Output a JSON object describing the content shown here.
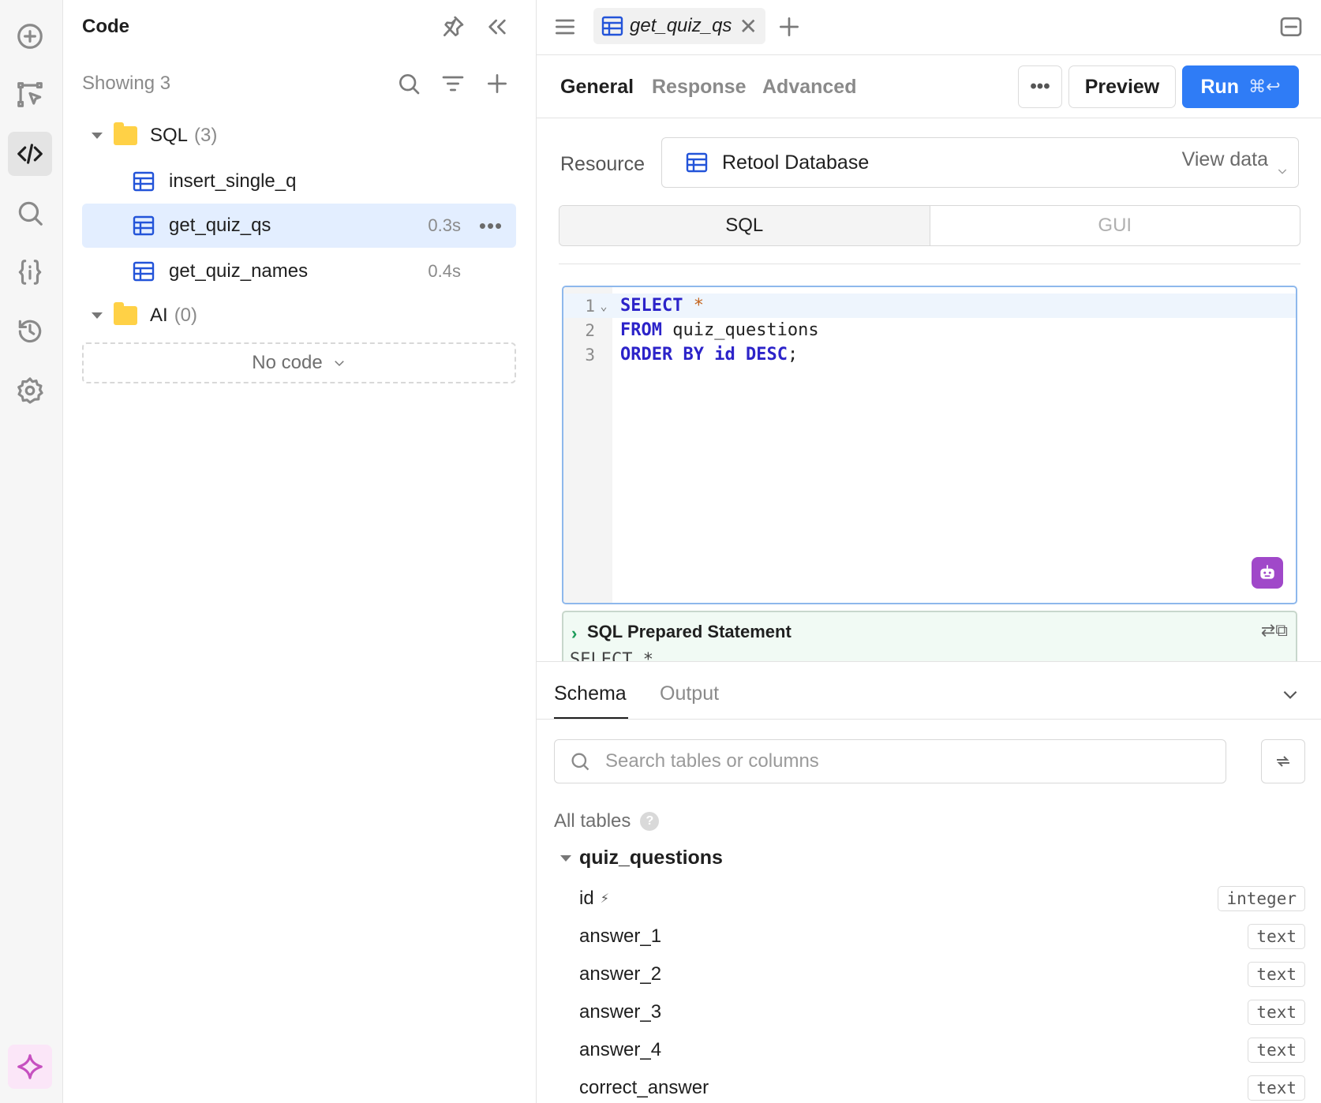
{
  "rail": {
    "items": [
      {
        "name": "add",
        "icon": "plus-circle-icon"
      },
      {
        "name": "components",
        "icon": "component-cursor-icon"
      },
      {
        "name": "code",
        "icon": "code-icon",
        "active": true
      },
      {
        "name": "search",
        "icon": "search-icon"
      },
      {
        "name": "state",
        "icon": "variables-icon"
      },
      {
        "name": "history",
        "icon": "history-icon"
      },
      {
        "name": "settings",
        "icon": "gear-icon"
      }
    ],
    "assist_icon": "sparkle-icon"
  },
  "code_panel": {
    "title": "Code",
    "showing": "Showing 3",
    "folders": [
      {
        "name": "SQL",
        "count": "(3)"
      },
      {
        "name": "AI",
        "count": "(0)"
      }
    ],
    "queries": [
      {
        "name": "insert_single_q",
        "time": ""
      },
      {
        "name": "get_quiz_qs",
        "time": "0.3s",
        "more": "•••"
      },
      {
        "name": "get_quiz_names",
        "time": "0.4s"
      }
    ],
    "no_code": "No code"
  },
  "editor": {
    "tab": {
      "name": "get_quiz_qs",
      "close": "✕"
    },
    "add_tab": "+",
    "subtabs": {
      "general": "General",
      "response": "Response",
      "advanced": "Advanced"
    },
    "more_label": "•••",
    "preview_label": "Preview",
    "run_label": "Run",
    "run_shortcut": "⌘↩",
    "resource_label": "Resource",
    "resource_value": "Retool Database",
    "view_data": "View data",
    "modes": {
      "sql": "SQL",
      "gui": "GUI"
    },
    "code_lines": [
      {
        "n": "1",
        "fold": "⌄"
      },
      {
        "n": "2"
      },
      {
        "n": "3"
      }
    ],
    "code": {
      "l1_kw": "SELECT",
      "l1_op": "*",
      "l2_kw": "FROM",
      "l2_rest": " quiz_questions",
      "l3_kw1": "ORDER BY",
      "l3_col": "id",
      "l3_kw2": "DESC",
      "l3_end": ";"
    },
    "prepared": {
      "title": "SQL Prepared Statement",
      "chevron": "›",
      "icons": "⇄⧉",
      "preview": "SELECT *"
    }
  },
  "bottom": {
    "tabs": {
      "schema": "Schema",
      "output": "Output"
    },
    "search_placeholder": "Search tables or columns",
    "all_tables": "All tables",
    "help": "?",
    "table_name": "quiz_questions",
    "columns": [
      {
        "name": "id",
        "type": "integer",
        "pk": true
      },
      {
        "name": "answer_1",
        "type": "text"
      },
      {
        "name": "answer_2",
        "type": "text"
      },
      {
        "name": "answer_3",
        "type": "text"
      },
      {
        "name": "answer_4",
        "type": "text"
      },
      {
        "name": "correct_answer",
        "type": "text"
      }
    ],
    "pk_icon": "⚡"
  },
  "colors": {
    "accent": "#2f7cf6",
    "selection": "#e3eeff",
    "folder": "#ffd146",
    "keyword": "#2c23c9",
    "ai": "#a048c9"
  }
}
